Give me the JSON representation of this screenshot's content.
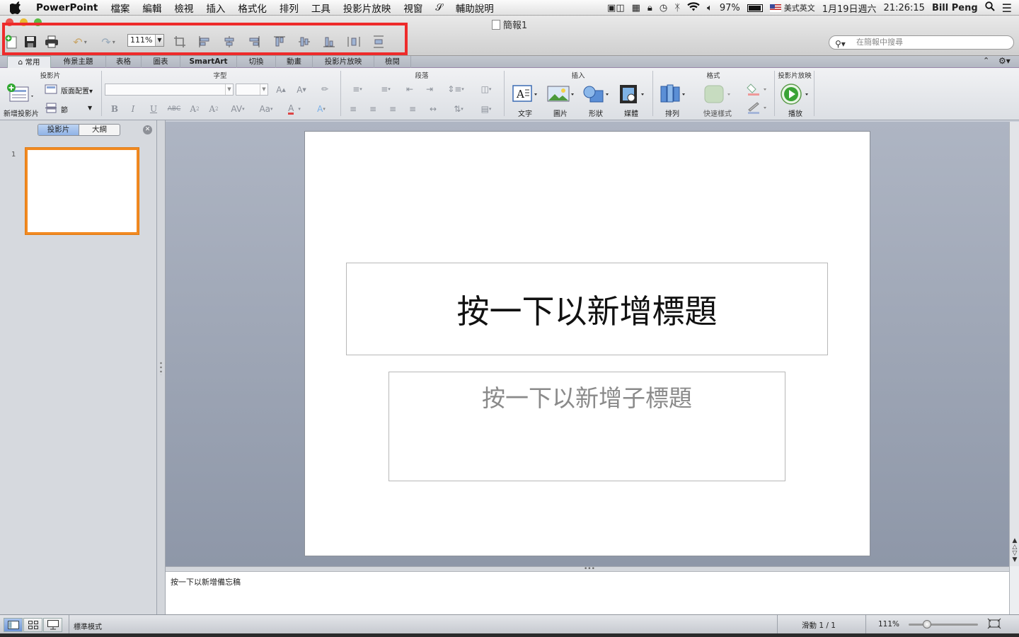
{
  "menubar": {
    "app_name": "PowerPoint",
    "items": [
      "檔案",
      "編輯",
      "檢視",
      "插入",
      "格式化",
      "排列",
      "工具",
      "投影片放映",
      "視窗",
      "輔助說明"
    ],
    "battery": "97%",
    "input_method": "美式英文",
    "date": "1月19日週六",
    "time": "21:26:15",
    "user": "Bill Peng"
  },
  "window": {
    "title": "簡報1",
    "zoom": "111%",
    "search_placeholder": "在簡報中搜尋"
  },
  "ribbon": {
    "tabs": [
      "常用",
      "佈景主題",
      "表格",
      "圖表",
      "SmartArt",
      "切換",
      "動畫",
      "投影片放映",
      "檢閱"
    ],
    "groups": {
      "slides": {
        "title": "投影片",
        "new_slide": "新增投影片",
        "layout": "版面配置",
        "section": "節"
      },
      "font": {
        "title": "字型"
      },
      "paragraph": {
        "title": "段落"
      },
      "insert": {
        "title": "插入",
        "text": "文字",
        "picture": "圖片",
        "shape": "形狀",
        "media": "媒體"
      },
      "format": {
        "title": "格式",
        "arrange": "排列",
        "quick_styles": "快速樣式"
      },
      "slideshow": {
        "title": "投影片放映",
        "play": "播放"
      }
    }
  },
  "left_panel": {
    "tab_slides": "投影片",
    "tab_outline": "大綱",
    "slide_number": "1"
  },
  "slide": {
    "title_placeholder": "按一下以新增標題",
    "subtitle_placeholder": "按一下以新增子標題"
  },
  "notes": {
    "placeholder": "按一下以新增備忘稿"
  },
  "statusbar": {
    "view_mode": "標準模式",
    "slide_position": "滑動 1 / 1",
    "zoom": "111%"
  },
  "colors": {
    "highlight": "#ee2b2b",
    "thumb_border": "#f28a22"
  }
}
